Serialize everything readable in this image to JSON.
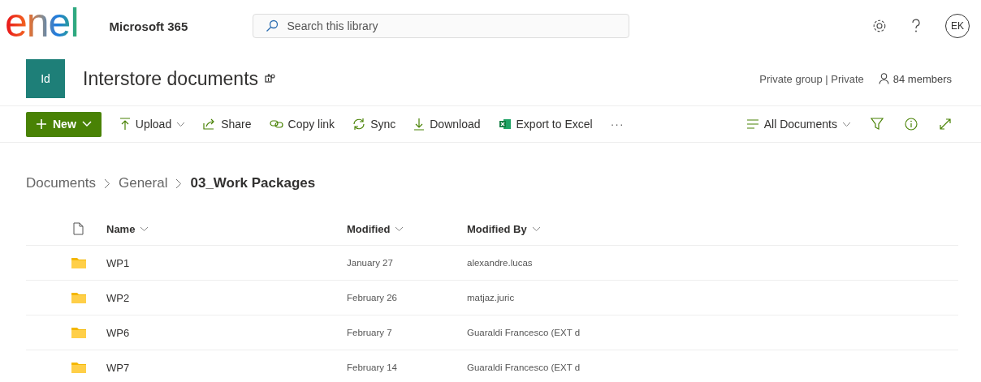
{
  "logo": {
    "text": "enel"
  },
  "app_name": "Microsoft 365",
  "search": {
    "placeholder": "Search this library"
  },
  "account": {
    "initials": "EK"
  },
  "site": {
    "badge": "Id",
    "title": "Interstore documents",
    "privacy": "Private group | Private",
    "members": "84 members"
  },
  "toolbar": {
    "new_button": "New",
    "commands": [
      "Upload",
      "Share",
      "Copy link",
      "Sync",
      "Download",
      "Export to Excel"
    ],
    "more": "···",
    "view": "All Documents"
  },
  "breadcrumb": [
    {
      "label": "Documents",
      "current": false
    },
    {
      "label": "General",
      "current": false
    },
    {
      "label": "03_Work Packages",
      "current": true
    }
  ],
  "table": {
    "columns": [
      "Name",
      "Modified",
      "Modified By"
    ],
    "rows": [
      {
        "name": "WP1",
        "modified": "January 27",
        "modified_by": "alexandre.lucas"
      },
      {
        "name": "WP2",
        "modified": "February 26",
        "modified_by": "matjaz.juric"
      },
      {
        "name": "WP6",
        "modified": "February 7",
        "modified_by": "Guaraldi Francesco (EXT d"
      },
      {
        "name": "WP7",
        "modified": "February 14",
        "modified_by": "Guaraldi Francesco (EXT d"
      }
    ]
  }
}
